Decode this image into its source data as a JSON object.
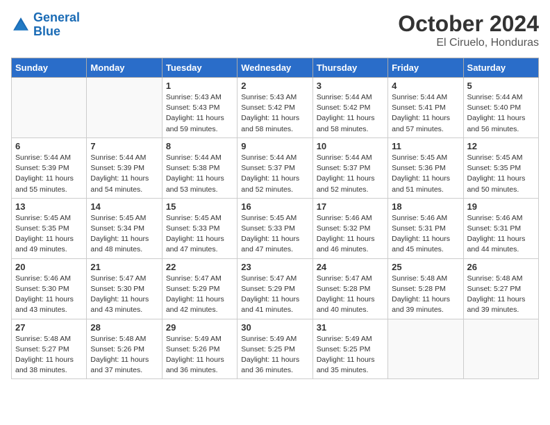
{
  "header": {
    "logo_line1": "General",
    "logo_line2": "Blue",
    "month": "October 2024",
    "location": "El Ciruelo, Honduras"
  },
  "days_of_week": [
    "Sunday",
    "Monday",
    "Tuesday",
    "Wednesday",
    "Thursday",
    "Friday",
    "Saturday"
  ],
  "weeks": [
    [
      {
        "day": "",
        "info": ""
      },
      {
        "day": "",
        "info": ""
      },
      {
        "day": "1",
        "info": "Sunrise: 5:43 AM\nSunset: 5:43 PM\nDaylight: 11 hours and 59 minutes."
      },
      {
        "day": "2",
        "info": "Sunrise: 5:43 AM\nSunset: 5:42 PM\nDaylight: 11 hours and 58 minutes."
      },
      {
        "day": "3",
        "info": "Sunrise: 5:44 AM\nSunset: 5:42 PM\nDaylight: 11 hours and 58 minutes."
      },
      {
        "day": "4",
        "info": "Sunrise: 5:44 AM\nSunset: 5:41 PM\nDaylight: 11 hours and 57 minutes."
      },
      {
        "day": "5",
        "info": "Sunrise: 5:44 AM\nSunset: 5:40 PM\nDaylight: 11 hours and 56 minutes."
      }
    ],
    [
      {
        "day": "6",
        "info": "Sunrise: 5:44 AM\nSunset: 5:39 PM\nDaylight: 11 hours and 55 minutes."
      },
      {
        "day": "7",
        "info": "Sunrise: 5:44 AM\nSunset: 5:39 PM\nDaylight: 11 hours and 54 minutes."
      },
      {
        "day": "8",
        "info": "Sunrise: 5:44 AM\nSunset: 5:38 PM\nDaylight: 11 hours and 53 minutes."
      },
      {
        "day": "9",
        "info": "Sunrise: 5:44 AM\nSunset: 5:37 PM\nDaylight: 11 hours and 52 minutes."
      },
      {
        "day": "10",
        "info": "Sunrise: 5:44 AM\nSunset: 5:37 PM\nDaylight: 11 hours and 52 minutes."
      },
      {
        "day": "11",
        "info": "Sunrise: 5:45 AM\nSunset: 5:36 PM\nDaylight: 11 hours and 51 minutes."
      },
      {
        "day": "12",
        "info": "Sunrise: 5:45 AM\nSunset: 5:35 PM\nDaylight: 11 hours and 50 minutes."
      }
    ],
    [
      {
        "day": "13",
        "info": "Sunrise: 5:45 AM\nSunset: 5:35 PM\nDaylight: 11 hours and 49 minutes."
      },
      {
        "day": "14",
        "info": "Sunrise: 5:45 AM\nSunset: 5:34 PM\nDaylight: 11 hours and 48 minutes."
      },
      {
        "day": "15",
        "info": "Sunrise: 5:45 AM\nSunset: 5:33 PM\nDaylight: 11 hours and 47 minutes."
      },
      {
        "day": "16",
        "info": "Sunrise: 5:45 AM\nSunset: 5:33 PM\nDaylight: 11 hours and 47 minutes."
      },
      {
        "day": "17",
        "info": "Sunrise: 5:46 AM\nSunset: 5:32 PM\nDaylight: 11 hours and 46 minutes."
      },
      {
        "day": "18",
        "info": "Sunrise: 5:46 AM\nSunset: 5:31 PM\nDaylight: 11 hours and 45 minutes."
      },
      {
        "day": "19",
        "info": "Sunrise: 5:46 AM\nSunset: 5:31 PM\nDaylight: 11 hours and 44 minutes."
      }
    ],
    [
      {
        "day": "20",
        "info": "Sunrise: 5:46 AM\nSunset: 5:30 PM\nDaylight: 11 hours and 43 minutes."
      },
      {
        "day": "21",
        "info": "Sunrise: 5:47 AM\nSunset: 5:30 PM\nDaylight: 11 hours and 43 minutes."
      },
      {
        "day": "22",
        "info": "Sunrise: 5:47 AM\nSunset: 5:29 PM\nDaylight: 11 hours and 42 minutes."
      },
      {
        "day": "23",
        "info": "Sunrise: 5:47 AM\nSunset: 5:29 PM\nDaylight: 11 hours and 41 minutes."
      },
      {
        "day": "24",
        "info": "Sunrise: 5:47 AM\nSunset: 5:28 PM\nDaylight: 11 hours and 40 minutes."
      },
      {
        "day": "25",
        "info": "Sunrise: 5:48 AM\nSunset: 5:28 PM\nDaylight: 11 hours and 39 minutes."
      },
      {
        "day": "26",
        "info": "Sunrise: 5:48 AM\nSunset: 5:27 PM\nDaylight: 11 hours and 39 minutes."
      }
    ],
    [
      {
        "day": "27",
        "info": "Sunrise: 5:48 AM\nSunset: 5:27 PM\nDaylight: 11 hours and 38 minutes."
      },
      {
        "day": "28",
        "info": "Sunrise: 5:48 AM\nSunset: 5:26 PM\nDaylight: 11 hours and 37 minutes."
      },
      {
        "day": "29",
        "info": "Sunrise: 5:49 AM\nSunset: 5:26 PM\nDaylight: 11 hours and 36 minutes."
      },
      {
        "day": "30",
        "info": "Sunrise: 5:49 AM\nSunset: 5:25 PM\nDaylight: 11 hours and 36 minutes."
      },
      {
        "day": "31",
        "info": "Sunrise: 5:49 AM\nSunset: 5:25 PM\nDaylight: 11 hours and 35 minutes."
      },
      {
        "day": "",
        "info": ""
      },
      {
        "day": "",
        "info": ""
      }
    ]
  ]
}
